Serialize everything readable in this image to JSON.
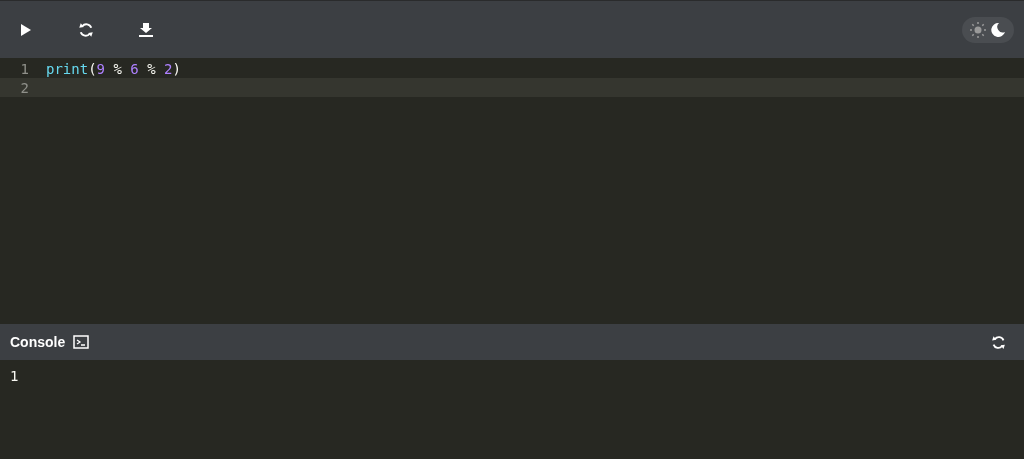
{
  "toolbar": {
    "buttons": [
      {
        "kind": "run"
      },
      {
        "kind": "reset"
      },
      {
        "kind": "download"
      }
    ],
    "theme": [
      {
        "kind": "light",
        "selected": false
      },
      {
        "kind": "dark",
        "selected": true
      }
    ]
  },
  "editor": {
    "lines": [
      {
        "number": "1",
        "active": false,
        "tokens": [
          {
            "kind": "function",
            "text": "print"
          },
          {
            "kind": "punct",
            "text": "("
          },
          {
            "kind": "number",
            "text": "9"
          },
          {
            "kind": "operator",
            "text": "%"
          },
          {
            "kind": "number",
            "text": "6"
          },
          {
            "kind": "operator",
            "text": "%"
          },
          {
            "kind": "number",
            "text": "2"
          },
          {
            "kind": "punct",
            "text": ")"
          }
        ]
      },
      {
        "number": "2",
        "active": true
      }
    ]
  },
  "console": {
    "title": "Console",
    "output": "1"
  }
}
